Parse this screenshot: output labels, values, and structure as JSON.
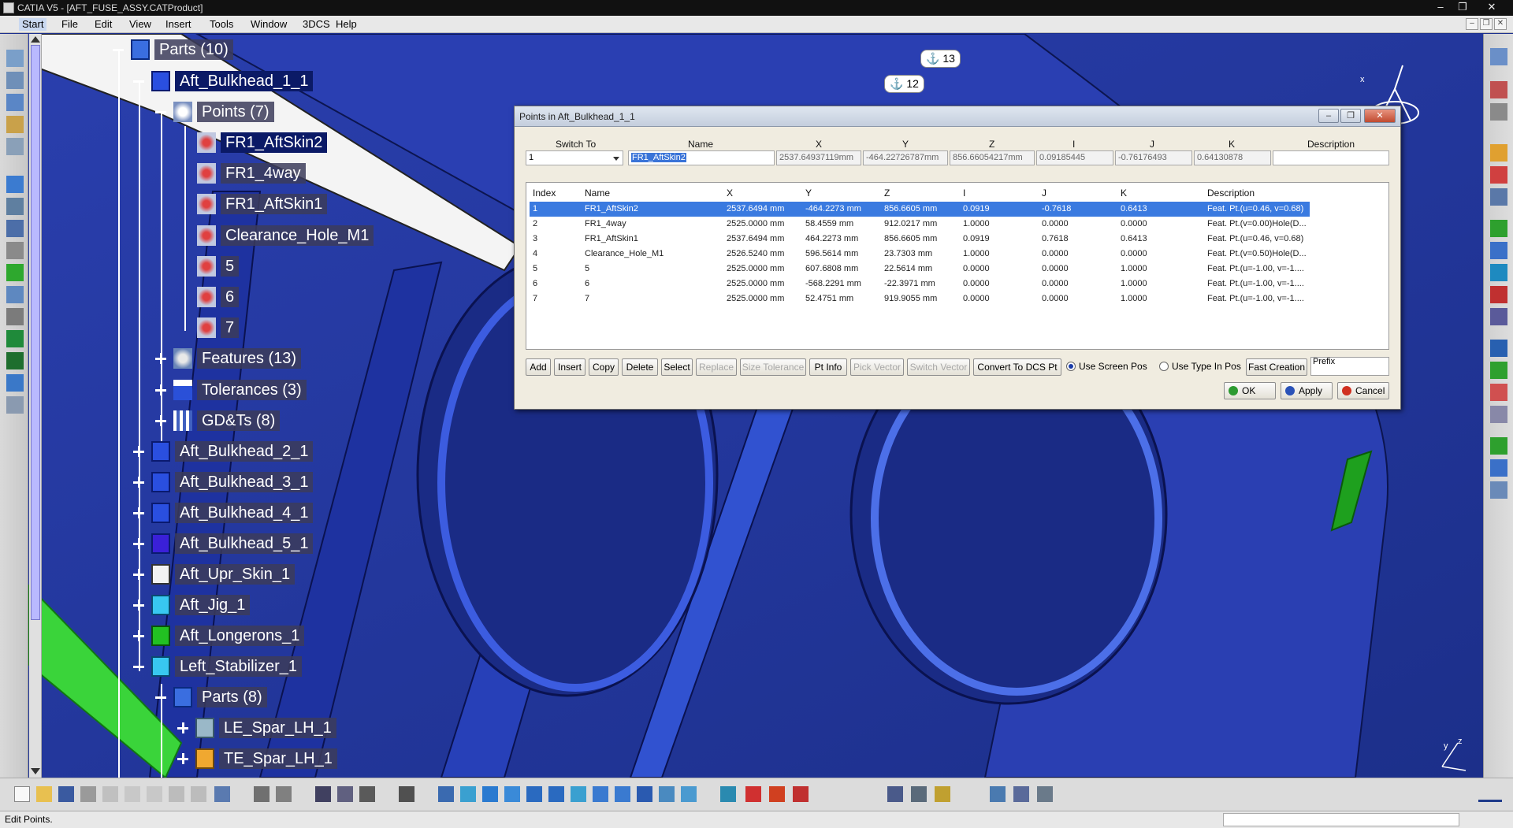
{
  "window": {
    "title": "CATIA V5 - [AFT_FUSE_ASSY.CATProduct]",
    "controls": [
      "–",
      "❐",
      "✕"
    ]
  },
  "menu": {
    "items": [
      "Start",
      "File",
      "Edit",
      "View",
      "Insert",
      "Tools",
      "Window",
      "3DCS",
      "Help"
    ],
    "mdi_controls": [
      "–",
      "❐",
      "✕"
    ]
  },
  "tree": {
    "nodes": [
      {
        "label": "Parts (10)",
        "icon": "parts-icon"
      },
      {
        "label": "Aft_Bulkhead_1_1",
        "icon": "part-icon"
      },
      {
        "label": "Points (7)",
        "icon": "points-icon"
      },
      {
        "label": "FR1_AftSkin2",
        "icon": "point-icon"
      },
      {
        "label": "FR1_4way",
        "icon": "point-icon"
      },
      {
        "label": "FR1_AftSkin1",
        "icon": "point-icon"
      },
      {
        "label": "Clearance_Hole_M1",
        "icon": "point-icon"
      },
      {
        "label": "5",
        "icon": "point-icon"
      },
      {
        "label": "6",
        "icon": "point-icon"
      },
      {
        "label": "7",
        "icon": "point-icon"
      },
      {
        "label": "Features (13)",
        "icon": "features-icon"
      },
      {
        "label": "Tolerances (3)",
        "icon": "tolerances-icon"
      },
      {
        "label": "GD&Ts (8)",
        "icon": "gdt-icon"
      },
      {
        "label": "Aft_Bulkhead_2_1",
        "icon": "part-icon"
      },
      {
        "label": "Aft_Bulkhead_3_1",
        "icon": "part-icon"
      },
      {
        "label": "Aft_Bulkhead_4_1",
        "icon": "part-icon"
      },
      {
        "label": "Aft_Bulkhead_5_1",
        "icon": "part-icon"
      },
      {
        "label": "Aft_Upr_Skin_1",
        "icon": "part-icon"
      },
      {
        "label": "Aft_Jig_1",
        "icon": "part-icon"
      },
      {
        "label": "Aft_Longerons_1",
        "icon": "part-icon"
      },
      {
        "label": "Left_Stabilizer_1",
        "icon": "part-icon"
      },
      {
        "label": "Parts (8)",
        "icon": "parts-icon"
      },
      {
        "label": "LE_Spar_LH_1",
        "icon": "part-icon"
      },
      {
        "label": "TE_Spar_LH_1",
        "icon": "part-icon"
      }
    ]
  },
  "viewport": {
    "bubble_13": "13",
    "bubble_12": "12",
    "axis_x": "x",
    "axis_y": "y",
    "axis_z": "z"
  },
  "dialog": {
    "title": "Points in Aft_Bulkhead_1_1",
    "controls": [
      "–",
      "❐",
      "✕"
    ],
    "edit_headers": [
      "Switch To",
      "Name",
      "X",
      "Y",
      "Z",
      "I",
      "J",
      "K",
      "Description"
    ],
    "edit_values": {
      "switch_to": "1",
      "name": "FR1_AftSkin2",
      "x": "2537.64937119mm",
      "y": "-464.22726787mm",
      "z": "856.66054217mm",
      "i": "0.09185445",
      "j": "-0.76176493",
      "k": "0.64130878",
      "description": ""
    },
    "table_headers": [
      "Index",
      "Name",
      "X",
      "Y",
      "Z",
      "I",
      "J",
      "K",
      "Description"
    ],
    "rows": [
      [
        "1",
        "FR1_AftSkin2",
        "2537.6494 mm",
        "-464.2273 mm",
        "856.6605 mm",
        "0.0919",
        "-0.7618",
        "0.6413",
        "Feat. Pt.(u=0.46, v=0.68)"
      ],
      [
        "2",
        "FR1_4way",
        "2525.0000 mm",
        "58.4559 mm",
        "912.0217 mm",
        "1.0000",
        "0.0000",
        "0.0000",
        "Feat. Pt.(v=0.00)Hole(D..."
      ],
      [
        "3",
        "FR1_AftSkin1",
        "2537.6494 mm",
        "464.2273 mm",
        "856.6605 mm",
        "0.0919",
        "0.7618",
        "0.6413",
        "Feat. Pt.(u=0.46, v=0.68)"
      ],
      [
        "4",
        "Clearance_Hole_M1",
        "2526.5240 mm",
        "596.5614 mm",
        "23.7303 mm",
        "1.0000",
        "0.0000",
        "0.0000",
        "Feat. Pt.(v=0.50)Hole(D..."
      ],
      [
        "5",
        "5",
        "2525.0000 mm",
        "607.6808 mm",
        "22.5614 mm",
        "0.0000",
        "0.0000",
        "1.0000",
        "Feat. Pt.(u=-1.00, v=-1...."
      ],
      [
        "6",
        "6",
        "2525.0000 mm",
        "-568.2291 mm",
        "-22.3971 mm",
        "0.0000",
        "0.0000",
        "1.0000",
        "Feat. Pt.(u=-1.00, v=-1...."
      ],
      [
        "7",
        "7",
        "2525.0000 mm",
        "52.4751 mm",
        "919.9055 mm",
        "0.0000",
        "0.0000",
        "1.0000",
        "Feat. Pt.(u=-1.00, v=-1...."
      ]
    ],
    "buttons": {
      "add": "Add",
      "insert": "Insert",
      "copy": "Copy",
      "delete": "Delete",
      "select": "Select",
      "replace": "Replace",
      "size_tolerance": "Size Tolerance",
      "pt_info": "Pt Info",
      "pick_vector": "Pick Vector",
      "switch_vector": "Switch Vector",
      "convert": "Convert To DCS Pt",
      "fast_creation": "Fast Creation",
      "ok": "OK",
      "apply": "Apply",
      "cancel": "Cancel"
    },
    "radios": {
      "use_screen_pos": "Use Screen Pos",
      "use_type_in_pos": "Use Type In Pos"
    },
    "prefix_label": "Prefix",
    "colors": {
      "selected_row": "#3a7ae0",
      "ok": "#2c9a30",
      "apply": "#2a52b8",
      "cancel": "#d03020"
    }
  },
  "status": {
    "text": "Edit Points."
  }
}
